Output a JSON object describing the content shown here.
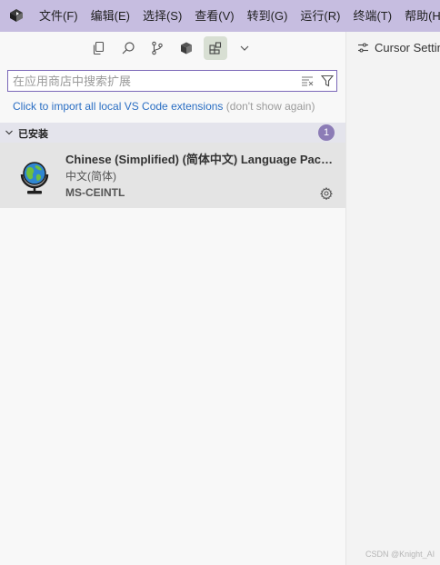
{
  "menubar": {
    "logo_icon": "cursor-cube-logo",
    "items": [
      {
        "label": "文件(F)"
      },
      {
        "label": "编辑(E)"
      },
      {
        "label": "选择(S)"
      },
      {
        "label": "查看(V)"
      },
      {
        "label": "转到(G)"
      },
      {
        "label": "运行(R)"
      },
      {
        "label": "终端(T)"
      },
      {
        "label": "帮助(H)"
      }
    ]
  },
  "toolbar": {
    "buttons": [
      {
        "icon": "explorer-icon"
      },
      {
        "icon": "search-icon"
      },
      {
        "icon": "source-control-icon"
      },
      {
        "icon": "cube-icon"
      },
      {
        "icon": "extensions-icon",
        "active": true
      },
      {
        "icon": "chevron-down-icon"
      }
    ]
  },
  "search": {
    "placeholder": "在应用商店中搜索扩展",
    "value": ""
  },
  "import_notice": {
    "link_text": "Click to import all local VS Code extensions",
    "dismiss_text": "(don't show again)"
  },
  "installed_section": {
    "title": "已安装",
    "count": "1"
  },
  "extensions": [
    {
      "name": "Chinese (Simplified) (简体中文) Language Pack for Visual Studio Code",
      "description": "中文(简体)",
      "publisher": "MS-CEINTL",
      "icon": "globe-icon"
    }
  ],
  "editor": {
    "tab_label": "Cursor Settings",
    "tab_icon": "settings-sliders-icon"
  },
  "watermark": "CSDN @Knight_AI",
  "colors": {
    "menubar_bg": "#c6bde0",
    "search_border": "#7b68b8",
    "link": "#2a6ec3",
    "badge": "#8c7cb6",
    "selected_item_bg": "#e4e4e4"
  }
}
